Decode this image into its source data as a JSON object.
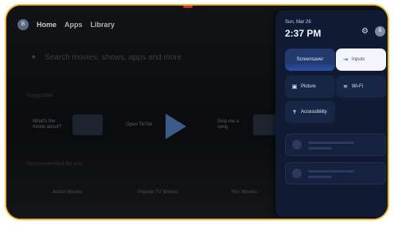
{
  "nav": {
    "avatar_initial": "B",
    "items": [
      "Home",
      "Apps",
      "Library"
    ]
  },
  "search": {
    "placeholder": "Search movies, shows, apps and more"
  },
  "home": {
    "section_title": "Suggested",
    "tiles": [
      {
        "label": "What's the movie about?"
      },
      {
        "label": "Open TikTok"
      },
      {
        "label": "Sing me a song"
      }
    ],
    "bottom_section_title": "Recommended for you",
    "bottom_items": [
      "Action Movies",
      "Popular TV Movies",
      "Rec Movies"
    ]
  },
  "quick_settings": {
    "date": "Sun, Mar 26",
    "time": "2:37 PM",
    "avatar_initial": "B",
    "tiles": [
      {
        "label": "Screensaver",
        "icon": "screensaver"
      },
      {
        "label": "Inputs",
        "icon": "input-icon"
      },
      {
        "label": "Picture",
        "icon": "picture-icon"
      },
      {
        "label": "Wi-Fi",
        "icon": "wifi-icon"
      },
      {
        "label": "Accessibility",
        "icon": "accessibility-icon"
      }
    ]
  },
  "colors": {
    "accent": "#f2b630",
    "panel": "#101b33",
    "tile": "#182645"
  }
}
